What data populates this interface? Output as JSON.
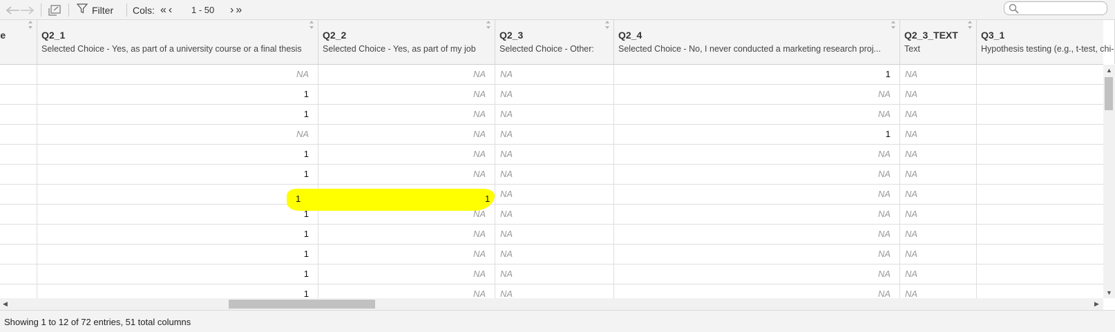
{
  "toolbar": {
    "filter_label": "Filter",
    "cols_label": "Cols:",
    "first_glyph": "«",
    "prev_glyph": "‹",
    "cols_range": "1 - 50",
    "next_glyph": "›",
    "last_glyph": "»"
  },
  "columns": [
    {
      "name": "age",
      "label": "ge"
    },
    {
      "name": "Q2_1",
      "label": "Selected Choice - Yes, as part of a university course or a final thesis"
    },
    {
      "name": "Q2_2",
      "label": "Selected Choice - Yes, as part of my job"
    },
    {
      "name": "Q2_3",
      "label": "Selected Choice - Other:"
    },
    {
      "name": "Q2_4",
      "label": "Selected Choice - No, I never conducted a marketing research proj..."
    },
    {
      "name": "Q2_3_TEXT",
      "label": "Text"
    },
    {
      "name": "Q3_1",
      "label": "Hypothesis testing (e.g., t-test, chi-"
    }
  ],
  "rows": [
    [
      "",
      "NA",
      "NA",
      "NA",
      "1",
      "NA",
      ""
    ],
    [
      "",
      "1",
      "NA",
      "NA",
      "NA",
      "NA",
      ""
    ],
    [
      "",
      "1",
      "NA",
      "NA",
      "NA",
      "NA",
      ""
    ],
    [
      "",
      "NA",
      "NA",
      "NA",
      "1",
      "NA",
      ""
    ],
    [
      "",
      "1",
      "NA",
      "NA",
      "NA",
      "NA",
      ""
    ],
    [
      "",
      "1",
      "NA",
      "NA",
      "NA",
      "NA",
      ""
    ],
    [
      "",
      "1",
      "1",
      "NA",
      "NA",
      "NA",
      ""
    ],
    [
      "",
      "1",
      "NA",
      "NA",
      "NA",
      "NA",
      ""
    ],
    [
      "",
      "1",
      "NA",
      "NA",
      "NA",
      "NA",
      ""
    ],
    [
      "",
      "1",
      "NA",
      "NA",
      "NA",
      "NA",
      ""
    ],
    [
      "",
      "1",
      "NA",
      "NA",
      "NA",
      "NA",
      ""
    ],
    [
      "",
      "1",
      "NA",
      "NA",
      "NA",
      "NA",
      ""
    ]
  ],
  "highlighted_row": 7,
  "highlight_color": "#ffff00",
  "footer": {
    "status": "Showing 1 to 12 of 72 entries, 51 total columns"
  },
  "icons": [
    "back-arrow-icon",
    "forward-arrow-icon",
    "popout-icon",
    "filter-icon",
    "search-icon",
    "sort-icon"
  ]
}
